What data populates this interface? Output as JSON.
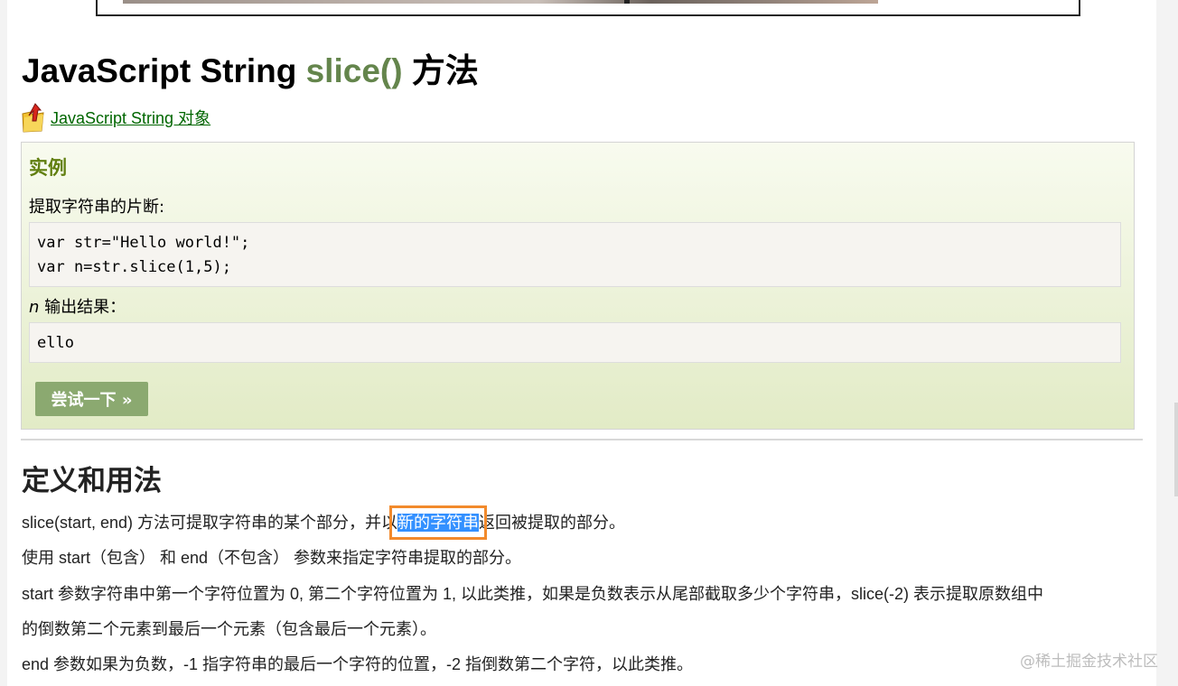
{
  "page": {
    "title_prefix": "JavaScript String ",
    "title_accent": "slice()",
    "title_suffix": " 方法",
    "back_link": "JavaScript String 对象",
    "back_icon": "folder-up-icon"
  },
  "example": {
    "heading": "实例",
    "description": "提取字符串的片断:",
    "code_lines": [
      "var str=\"Hello world!\";",
      "var n=str.slice(1,5);"
    ],
    "output_var": "n",
    "output_label": " 输出结果：",
    "output": "ello",
    "try_button": "尝试一下 »"
  },
  "definition": {
    "title": "定义和用法",
    "p1_before": "slice(start, end) 方法可提取字符串的某个部分，并以",
    "p1_highlight": "新的字符串",
    "p1_after": "返回被提取的部分。",
    "p2": "使用 start（包含） 和 end（不包含） 参数来指定字符串提取的部分。",
    "p3": "start 参数字符串中第一个字符位置为 0, 第二个字符位置为 1, 以此类推，如果是负数表示从尾部截取多少个字符串，slice(-2) 表示提取原数组中",
    "p4": "的倒数第二个元素到最后一个元素（包含最后一个元素）。",
    "p5": "end 参数如果为负数，-1 指字符串的最后一个字符的位置，-2 指倒数第二个字符，以此类推。"
  },
  "watermark": "@稀土掘金技术社区",
  "colors": {
    "accent": "#64854c",
    "link": "#006600",
    "example_heading": "#617f10",
    "button": "#8ba970",
    "selection": "#3390ff",
    "annotation_box": "#f28a2c"
  }
}
